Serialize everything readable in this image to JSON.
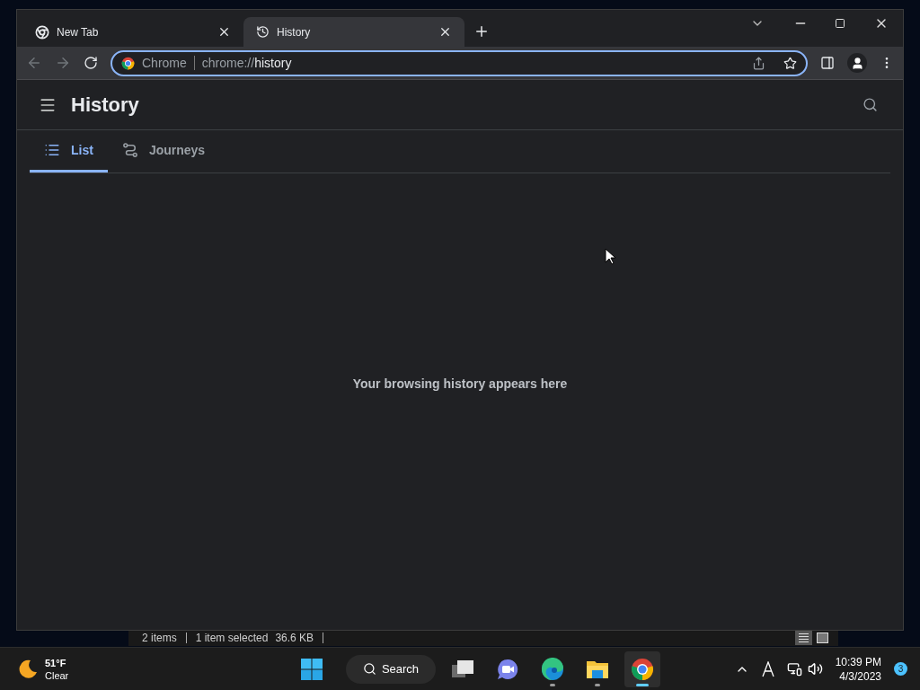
{
  "browser": {
    "tabs": [
      {
        "title": "New Tab",
        "selected": false,
        "kind": "chrome"
      },
      {
        "title": "History",
        "selected": true,
        "kind": "history"
      }
    ],
    "omnibox": {
      "chip": "Chrome",
      "url_prefix": "chrome://",
      "url_path": "history"
    },
    "page": {
      "title": "History",
      "tabs": [
        {
          "label": "List",
          "selected": true,
          "kind": "list"
        },
        {
          "label": "Journeys",
          "selected": false,
          "kind": "journeys"
        }
      ],
      "empty_message": "Your browsing history appears here"
    }
  },
  "explorer_status": {
    "items": "2 items",
    "selection": "1 item selected",
    "size": "36.6 KB"
  },
  "taskbar": {
    "weather": {
      "temp": "51°F",
      "condition": "Clear"
    },
    "search": "Search",
    "apps": [
      {
        "kind": "taskview",
        "running": false,
        "selected": false
      },
      {
        "kind": "chat",
        "running": false,
        "selected": false
      },
      {
        "kind": "edge",
        "running": true,
        "selected": false
      },
      {
        "kind": "files",
        "running": true,
        "selected": false
      },
      {
        "kind": "chrome",
        "running": true,
        "selected": true
      }
    ],
    "time": "10:39 PM",
    "date": "4/3/2023",
    "notifications": "3"
  }
}
